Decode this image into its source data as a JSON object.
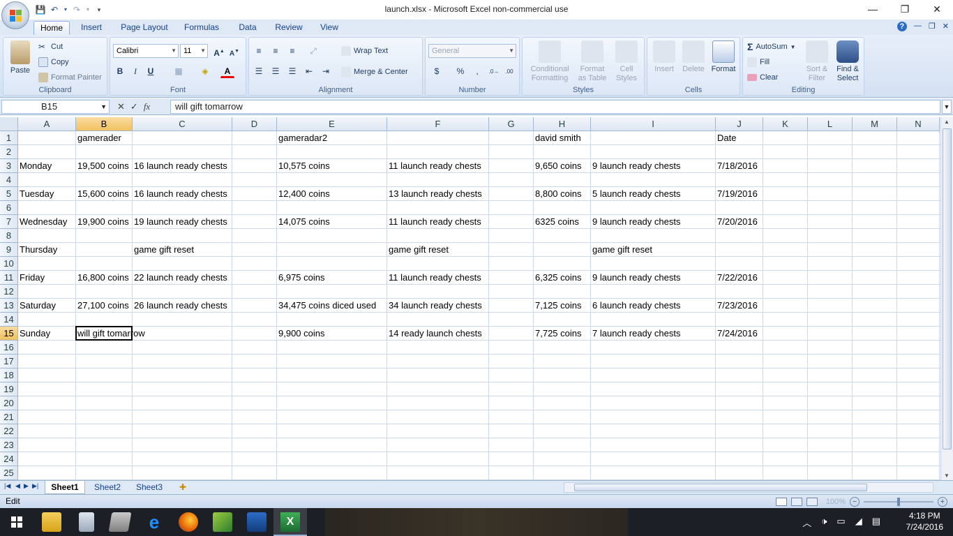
{
  "window": {
    "title": "launch.xlsx - Microsoft Excel non-commercial use",
    "minimize": "—",
    "restore": "❐",
    "close": "✕"
  },
  "ribbon_tabs": [
    "Home",
    "Insert",
    "Page Layout",
    "Formulas",
    "Data",
    "Review",
    "View"
  ],
  "clipboard": {
    "paste": "Paste",
    "cut": "Cut",
    "copy": "Copy",
    "format_painter": "Format Painter",
    "label": "Clipboard"
  },
  "font": {
    "name": "Calibri",
    "size": "11",
    "label": "Font",
    "bold": "B",
    "italic": "I",
    "underline": "U"
  },
  "alignment": {
    "wrap": "Wrap Text",
    "merge": "Merge & Center",
    "label": "Alignment"
  },
  "number": {
    "format": "General",
    "label": "Number",
    "currency": "$",
    "percent": "%",
    "comma": ","
  },
  "styles": {
    "conditional": "Conditional",
    "conditional2": "Formatting",
    "format_table": "Format",
    "format_table2": "as Table",
    "cell_styles": "Cell",
    "cell_styles2": "Styles",
    "label": "Styles"
  },
  "cells_group": {
    "insert": "Insert",
    "delete": "Delete",
    "format": "Format",
    "label": "Cells"
  },
  "editing": {
    "autosum": "AutoSum",
    "fill": "Fill",
    "clear": "Clear",
    "sort": "Sort &",
    "sort2": "Filter",
    "find": "Find &",
    "find2": "Select",
    "label": "Editing"
  },
  "formula_bar": {
    "name_box": "B15",
    "content": "will gift tomarrow",
    "fx": "fx"
  },
  "columns": [
    "A",
    "B",
    "C",
    "D",
    "E",
    "F",
    "G",
    "H",
    "I",
    "J",
    "K",
    "L",
    "M",
    "N"
  ],
  "rows": [
    "1",
    "2",
    "3",
    "4",
    "5",
    "6",
    "7",
    "8",
    "9",
    "10",
    "11",
    "12",
    "13",
    "14",
    "15",
    "16",
    "17",
    "18",
    "19",
    "20",
    "21",
    "22",
    "23",
    "24",
    "25"
  ],
  "cells": {
    "B1": "gamerader",
    "E1": "gameradar2",
    "H1": "david smith",
    "J1": "Date",
    "A3": "Monday",
    "B3": "19,500 coins",
    "C3": "16 launch ready chests",
    "E3": "10,575 coins",
    "F3": "11 launch ready chests",
    "H3": "9,650 coins",
    "I3": "9 launch ready chests",
    "J3": "7/18/2016",
    "A5": "Tuesday",
    "B5": "15,600 coins",
    "C5": "16 launch ready chests",
    "E5": "12,400 coins",
    "F5": "13 launch ready chests",
    "H5": "8,800 coins",
    "I5": "5 launch ready chests",
    "J5": "7/19/2016",
    "A7": "Wednesday",
    "B7": "19,900 coins",
    "C7": "19 launch ready chests",
    "E7": "14,075 coins",
    "F7": "11 launch ready chests",
    "H7": "6325 coins",
    "I7": "9 launch ready chests",
    "J7": "7/20/2016",
    "A9": "Thursday",
    "C9": "game gift reset",
    "F9": "game gift reset",
    "I9": "game gift reset",
    "A11": "Friday",
    "B11": "16,800 coins",
    "C11": "22 launch ready chests",
    "E11": "6,975 coins",
    "F11": "11 launch ready chests",
    "H11": "6,325 coins",
    "I11": "9 launch ready chests",
    "J11": "7/22/2016",
    "A13": "Saturday",
    "B13": "27,100 coins",
    "C13": "26 launch ready chests",
    "E13": "34,475 coins diced used",
    "F13": "34 launch ready chests",
    "H13": "7,125 coins",
    "I13": "6 launch ready chests",
    "J13": "7/23/2016",
    "A15": "Sunday",
    "B15": "will gift tomarrow",
    "E15": "9,900 coins",
    "F15": "14 ready launch chests",
    "H15": "7,725 coins",
    "I15": "7 launch ready chests",
    "J15": "7/24/2016"
  },
  "sheets": [
    "Sheet1",
    "Sheet2",
    "Sheet3"
  ],
  "status": {
    "mode": "Edit",
    "zoom": "100%"
  },
  "clock": {
    "time": "4:18 PM",
    "date": "7/24/2016"
  }
}
